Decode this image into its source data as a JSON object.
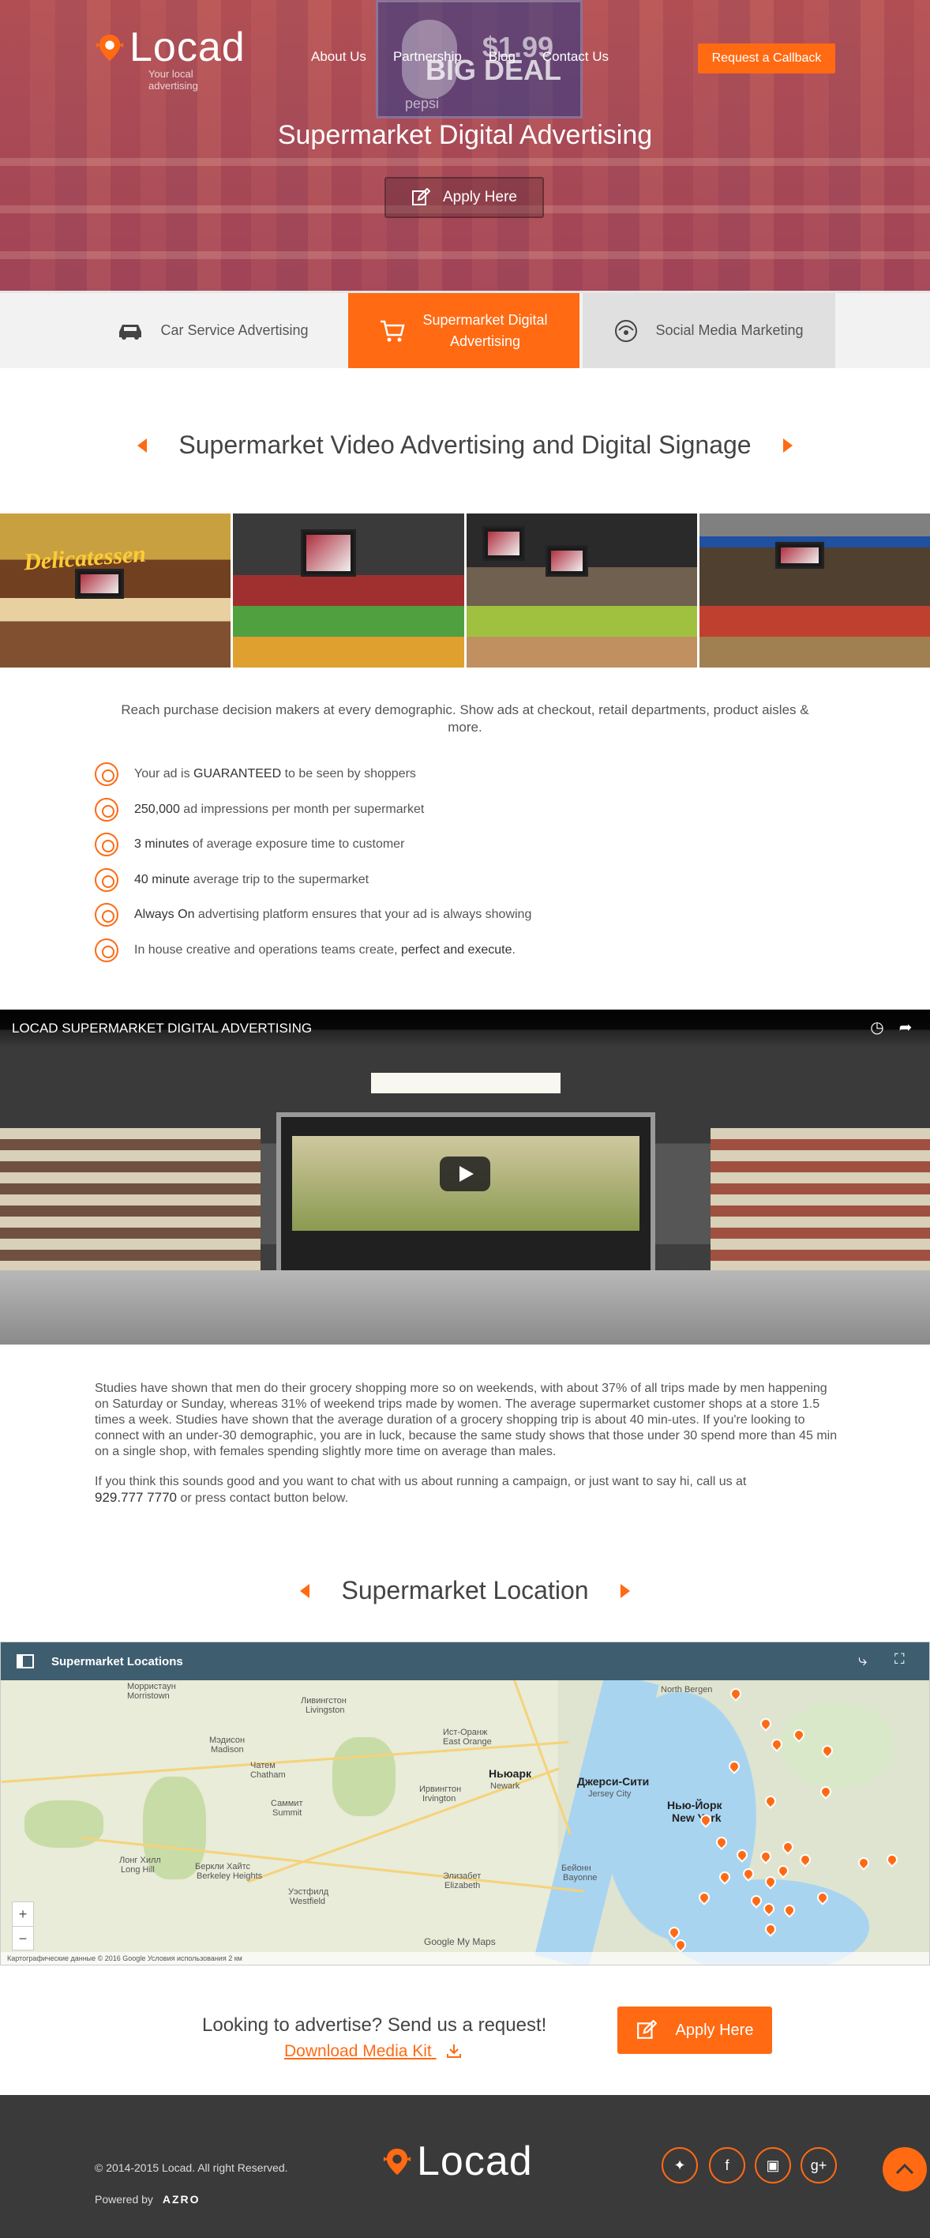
{
  "brand": {
    "name": "Locad",
    "tagline": "Your local advertising",
    "accent": "#ff6a13"
  },
  "nav": {
    "items": [
      "About Us",
      "Partnership",
      "Blog",
      "Contact Us"
    ],
    "callback": "Request a Callback"
  },
  "hero": {
    "title": "Supermarket Digital Advertising",
    "apply": "Apply Here",
    "sign_price": "$1.99",
    "sign_deal": "BIG DEAL",
    "sign_brand": "pepsi"
  },
  "tabs": [
    {
      "label": "Car Service Advertising",
      "icon": "car-icon"
    },
    {
      "label_line1": "Supermarket Digital",
      "label_line2": "Advertising",
      "icon": "cart-icon",
      "active": true
    },
    {
      "label": "Social Media Marketing",
      "icon": "social-icon"
    }
  ],
  "section1": {
    "title": "Supermarket Video Advertising and Digital Signage"
  },
  "gallery": {
    "caption1": "Delicatessen"
  },
  "intro": "Reach purchase decision makers at every demographic. Show ads at checkout, retail departments, product aisles & more.",
  "features": [
    {
      "strong": "",
      "pre": "Your ad is ",
      "mid": "GUARANTEED",
      "post": " to be seen by shoppers"
    },
    {
      "pre": "",
      "mid": "250,000",
      "post": " ad impressions per month per supermarket"
    },
    {
      "pre": "",
      "mid": "3 minutes",
      "post": " of average exposure time to customer"
    },
    {
      "pre": "",
      "mid": "40 minute",
      "post": " average trip to the supermarket"
    },
    {
      "pre": "",
      "mid": "Always On",
      "post": " advertising platform ensures that your ad is always showing"
    },
    {
      "pre": "In house creative and operations teams create, ",
      "mid": "perfect and execute",
      "post": "."
    }
  ],
  "video": {
    "title": "LOCAD SUPERMARKET DIGITAL ADVERTISING"
  },
  "body": {
    "p1": "Studies have shown that men do their grocery shopping more so on weekends, with about 37% of all trips made by men happening on Saturday or Sunday, whereas 31% of weekend trips made by women. The average supermarket customer shops at a store 1.5 times a week. Studies have shown that the average duration of a grocery shopping trip is about 40 min-utes. If you're looking to connect with an under-30 demographic, you are in luck, because the same study shows that those under 30 spend more than 45 min on a single shop, with females spending slightly more time on average than males.",
    "p2_pre": "If you think this sounds good and you want to chat with us about running a campaign, or just want to say hi, call us at",
    "phone": "929.777 7770",
    "p2_post": " or press contact button below."
  },
  "section2": {
    "title": "Supermarket Location"
  },
  "map": {
    "title": "Supermarket Locations",
    "labels": [
      "Морристаун",
      "Morristown",
      "Ливингстон",
      "Livingston",
      "Ист-Оранж",
      "East Orange",
      "Ньюарк",
      "Newark",
      "Джерси-Сити",
      "Jersey City",
      "Нью-Йорк",
      "New York",
      "Мэдисон",
      "Madison",
      "Чатем",
      "Chatham",
      "Саммит",
      "Summit",
      "Ирвингтон",
      "Irvington",
      "Элизабет",
      "Elizabeth",
      "Бейонн",
      "Bayonne",
      "Уэстфилд",
      "Westfield",
      "North Bergen",
      "Лонг Хилл",
      "Long Hill",
      "Беркли Хайтс",
      "Berkeley Heights"
    ],
    "footer": "Картографические данные © 2016 Google   Условия использования   2 км",
    "google": "Google My Maps"
  },
  "cta": {
    "text": "Looking to advertise? Send us a request!",
    "media_kit": "Download Media Kit",
    "apply": "Apply Here"
  },
  "footer": {
    "copyright": "© 2014-2015 Locad. All right Reserved.",
    "powered": "Powered by",
    "powered_brand": "AZRO"
  }
}
